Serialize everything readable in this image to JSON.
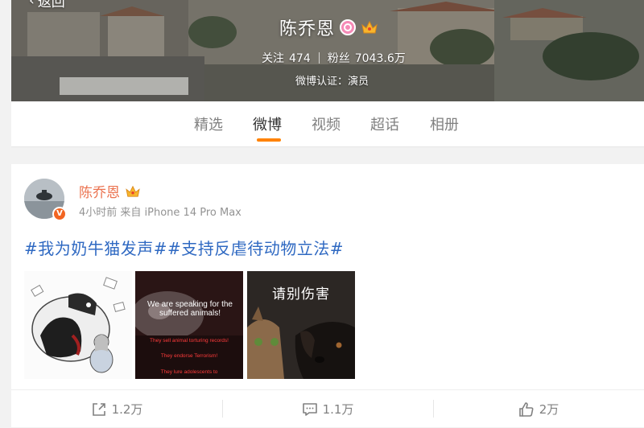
{
  "header": {
    "back_label": "返回",
    "name": "陈乔恩",
    "stats": {
      "following_label": "关注",
      "following_count": "474",
      "followers_label": "粉丝",
      "followers_count": "7043.6万"
    },
    "verification": "微博认证：演员"
  },
  "tabs": [
    {
      "label": "精选"
    },
    {
      "label": "微博"
    },
    {
      "label": "视频"
    },
    {
      "label": "超话"
    },
    {
      "label": "相册"
    }
  ],
  "active_tab": "微博",
  "post": {
    "author": "陈乔恩",
    "meta": "4小时前 来自 iPhone 14 Pro Max",
    "text": "#我为奶牛猫发声##支持反虐待动物立法#",
    "images": {
      "img2": {
        "top_caption": "We are speaking for the suffered animals!",
        "line1": "They sell animal torturing records!",
        "line2": "They endorse Terrorism!",
        "line3": "They lure adolescents to"
      },
      "img3": {
        "caption": "请别伤害"
      }
    },
    "actions": {
      "repost_count": "1.2万",
      "comment_count": "1.1万",
      "like_count": "2万"
    }
  },
  "colors": {
    "accent": "#ff8200",
    "author": "#eb7350",
    "topic": "#2f69c2"
  }
}
